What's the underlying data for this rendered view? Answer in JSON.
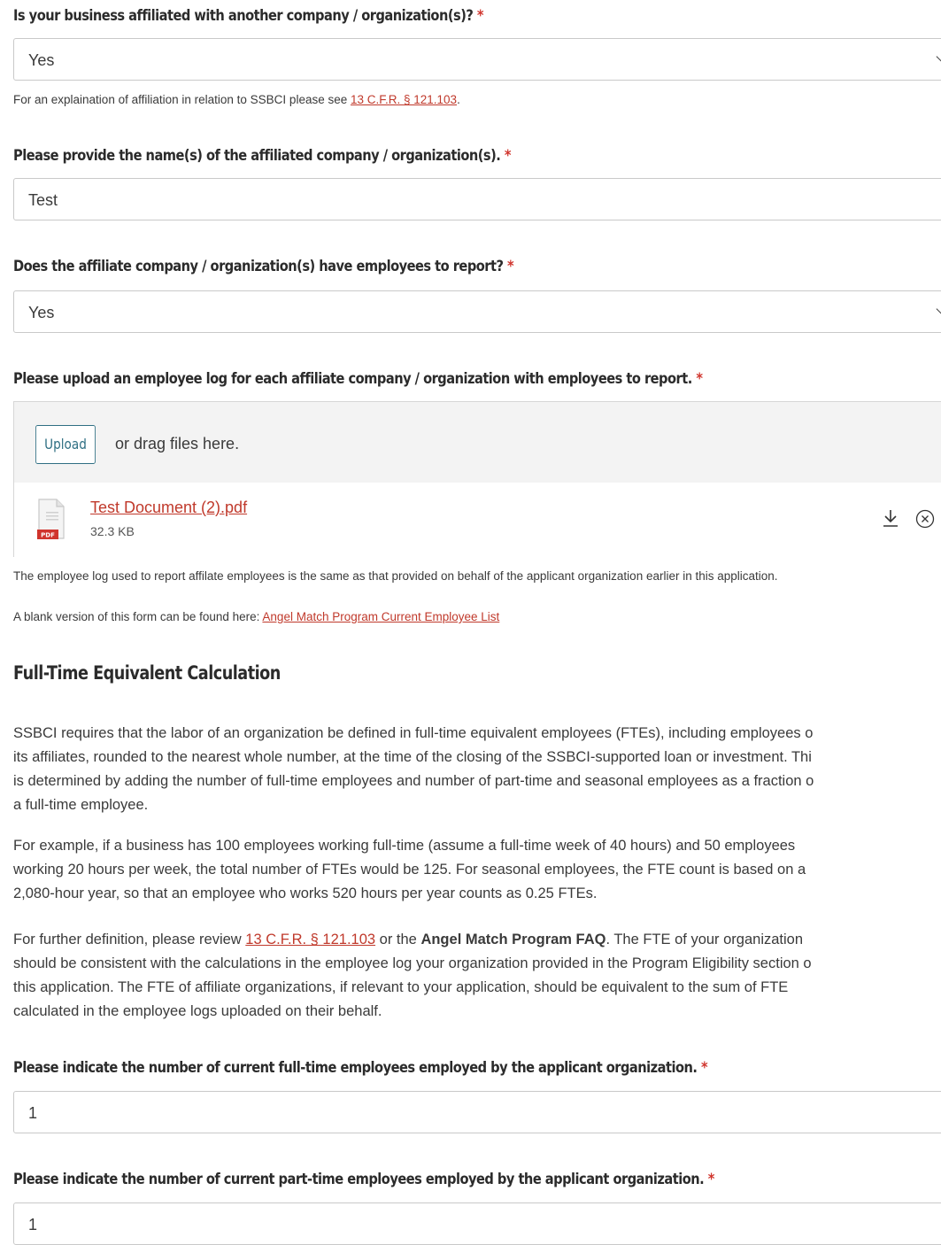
{
  "q_affiliated": {
    "label": "Is your business affiliated with another company / organization(s)?",
    "required_mark": "*",
    "value": "Yes",
    "help_prefix": "For an explaination of affiliation in relation to SSBCI please see ",
    "help_link": "13 C.F.R. § 121.103",
    "help_suffix": "."
  },
  "q_affiliate_names": {
    "label": "Please provide the name(s) of the affiliated company / organization(s).",
    "required_mark": "*",
    "value": "Test"
  },
  "q_affiliate_employees": {
    "label": "Does the affiliate company / organization(s) have employees to report?",
    "required_mark": "*",
    "value": "Yes"
  },
  "q_upload": {
    "label": "Please upload an employee log for each affiliate company / organization with employees to report.",
    "required_mark": "*",
    "upload_button": "Upload",
    "drag_text": "or drag files here.",
    "file": {
      "name": "Test Document (2).pdf",
      "size": "32.3 KB",
      "type_badge": "PDF",
      "icon": "pdf-file-icon"
    },
    "help_1": "The employee log used to report affilate employees is the same as that provided on behalf of the applicant organization earlier in this application.",
    "help_2_prefix": "A blank version of this form can be found here: ",
    "help_2_link": "Angel Match Program Current Employee List"
  },
  "fte_section": {
    "title": "Full-Time Equivalent Calculation",
    "para1_lines": [
      "SSBCI requires that the labor of an organization be defined in full-time equivalent employees (FTEs), including employees o",
      "its affiliates, rounded to the nearest whole number, at the time of the closing of the SSBCI-supported loan or investment. Thi",
      "is determined by adding the number of full-time employees and number of part-time and seasonal employees as a fraction o",
      "a full-time employee."
    ],
    "para2_lines": [
      "For example, if a business has 100 employees working full-time (assume a full-time week of 40 hours) and 50 employees",
      "working 20 hours per week, the total number of FTEs would be 125. For seasonal employees, the FTE count is based on a",
      "2,080-hour year, so that an employee who works 520 hours per year counts as 0.25 FTEs."
    ],
    "para3_line1_prefix": "For further definition, please review ",
    "para3_link": "13 C.F.R. § 121.103",
    "para3_line1_mid": " or the ",
    "para3_faq": "Angel Match Program FAQ",
    "para3_line1_suffix": ". The FTE of your organization",
    "para3_lines": [
      "should be consistent with the calculations in the employee log your organization provided in the Program Eligibility section o",
      "this application. The FTE of affiliate organizations, if relevant to your application, should be equivalent to the sum of FTE",
      "calculated in the employee logs uploaded on their behalf."
    ]
  },
  "q_fulltime": {
    "label": "Please indicate the number of current full-time employees employed by the applicant organization.",
    "required_mark": "*",
    "value": "1"
  },
  "q_parttime": {
    "label": "Please indicate the number of current part-time employees employed by the applicant organization.",
    "required_mark": "*",
    "value": "1"
  },
  "colors": {
    "link": "#c0392b",
    "required": "#d0342c",
    "upload_accent": "#2f6f83"
  }
}
